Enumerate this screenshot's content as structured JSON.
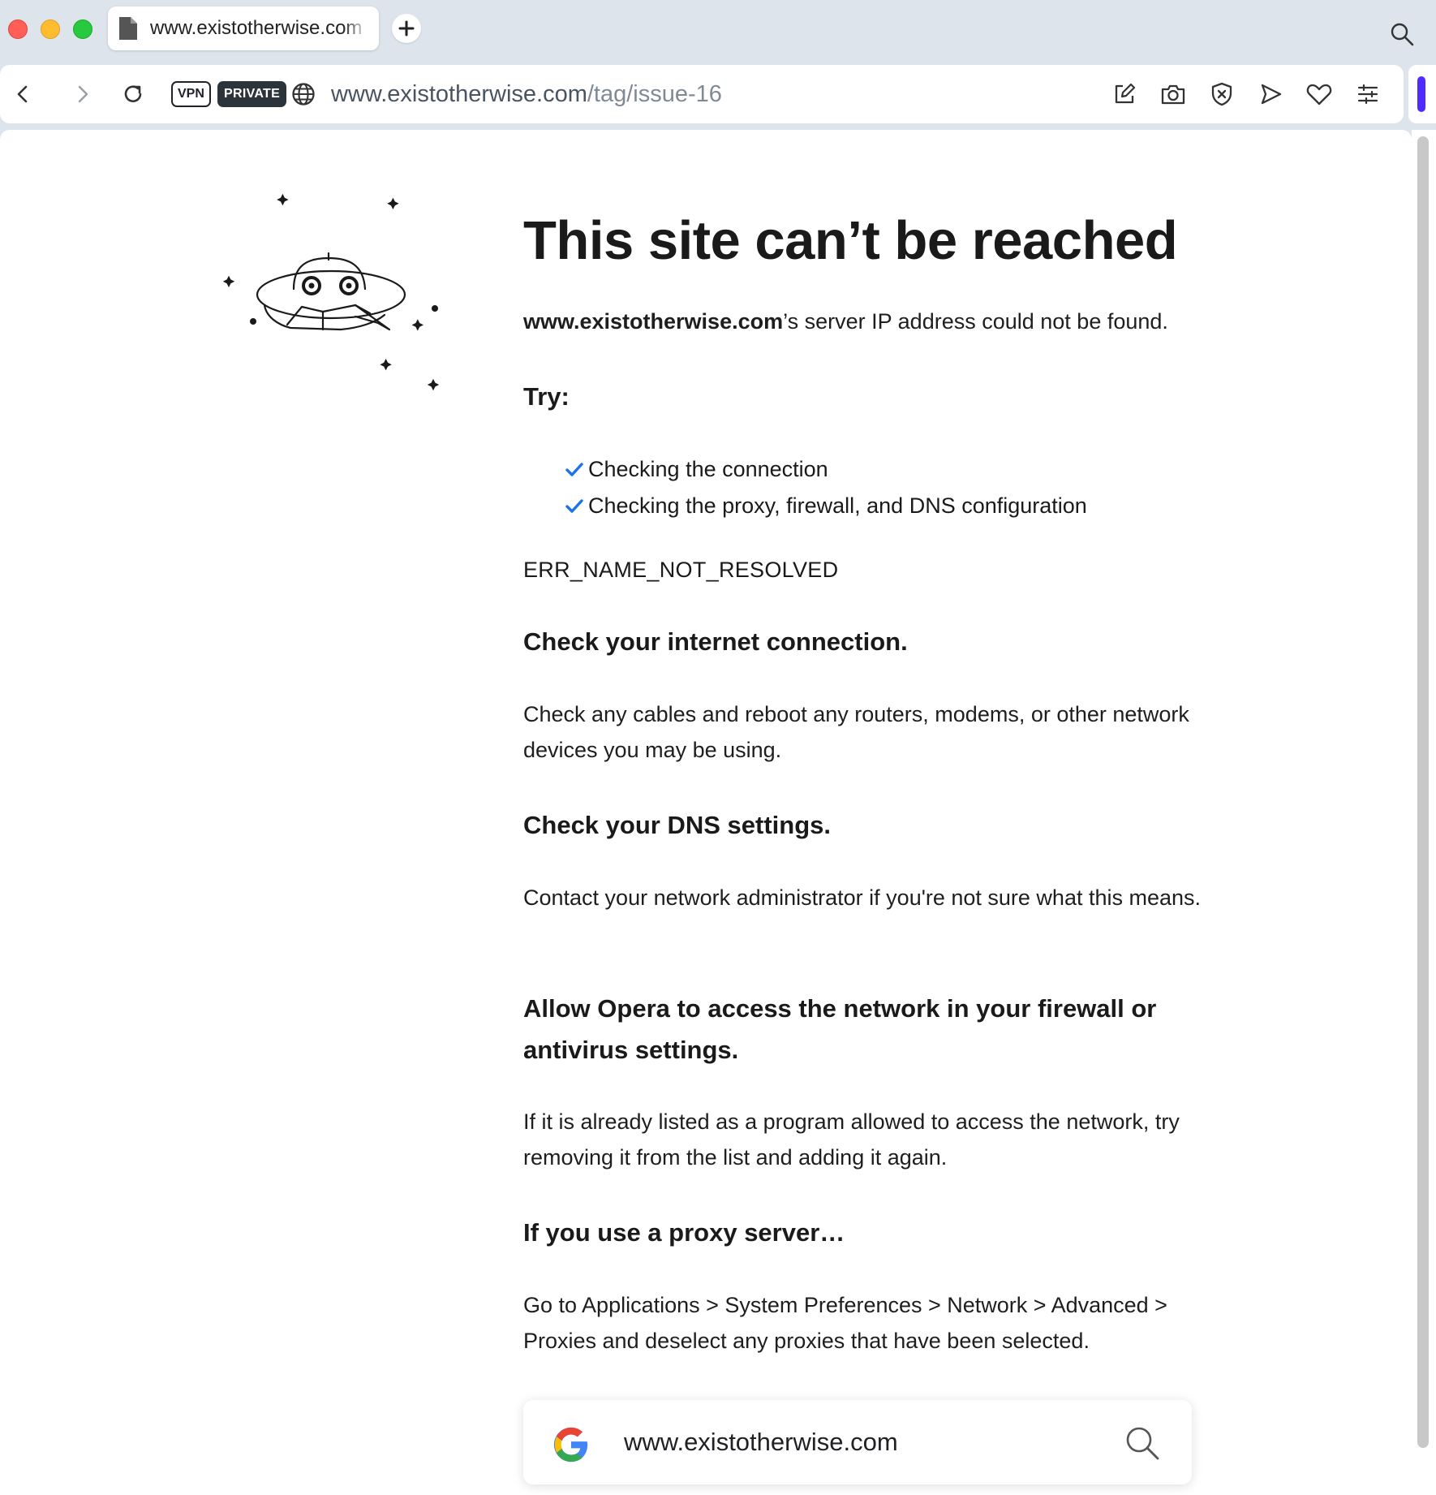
{
  "browser": {
    "tab_title": "www.existotherwise.com",
    "new_tab_icon": "plus-icon",
    "vpn_badge": "VPN",
    "private_badge": "PRIVATE",
    "url_host": "www.existotherwise.com",
    "url_path": "/tag/issue-16",
    "accent_color": "#4f2bff",
    "toolbar_icons": [
      "edit-snapshot-icon",
      "camera-icon",
      "shield-icon",
      "send-icon",
      "heart-icon",
      "menu-icon"
    ]
  },
  "error": {
    "title": "This site can’t be reached",
    "host_bold": "www.existotherwise.com",
    "host_suffix": "’s server IP address could not be found.",
    "try_heading": "Try:",
    "try_items": [
      "Checking the connection",
      "Checking the proxy, firewall, and DNS configuration"
    ],
    "code": "ERR_NAME_NOT_RESOLVED",
    "check_color": "#1a73e8",
    "sections": [
      {
        "heading": "Check your internet connection.",
        "body": "Check any cables and reboot any routers, modems, or other network devices you may be using."
      },
      {
        "heading": "Check your DNS settings.",
        "body": "Contact your network administrator if you're not sure what this means."
      },
      {
        "heading": "Allow Opera to access the network in your firewall or antivirus settings.",
        "body": "If it is already listed as a program allowed to access the network, try removing it from the list and adding it again."
      },
      {
        "heading": "If you use a proxy server…",
        "body": "Go to Applications > System Preferences > Network > Advanced > Proxies and deselect any proxies that have been selected."
      }
    ]
  },
  "search_box": {
    "query": "www.existotherwise.com",
    "engine_icon": "google-logo-icon",
    "search_icon": "search-icon"
  }
}
